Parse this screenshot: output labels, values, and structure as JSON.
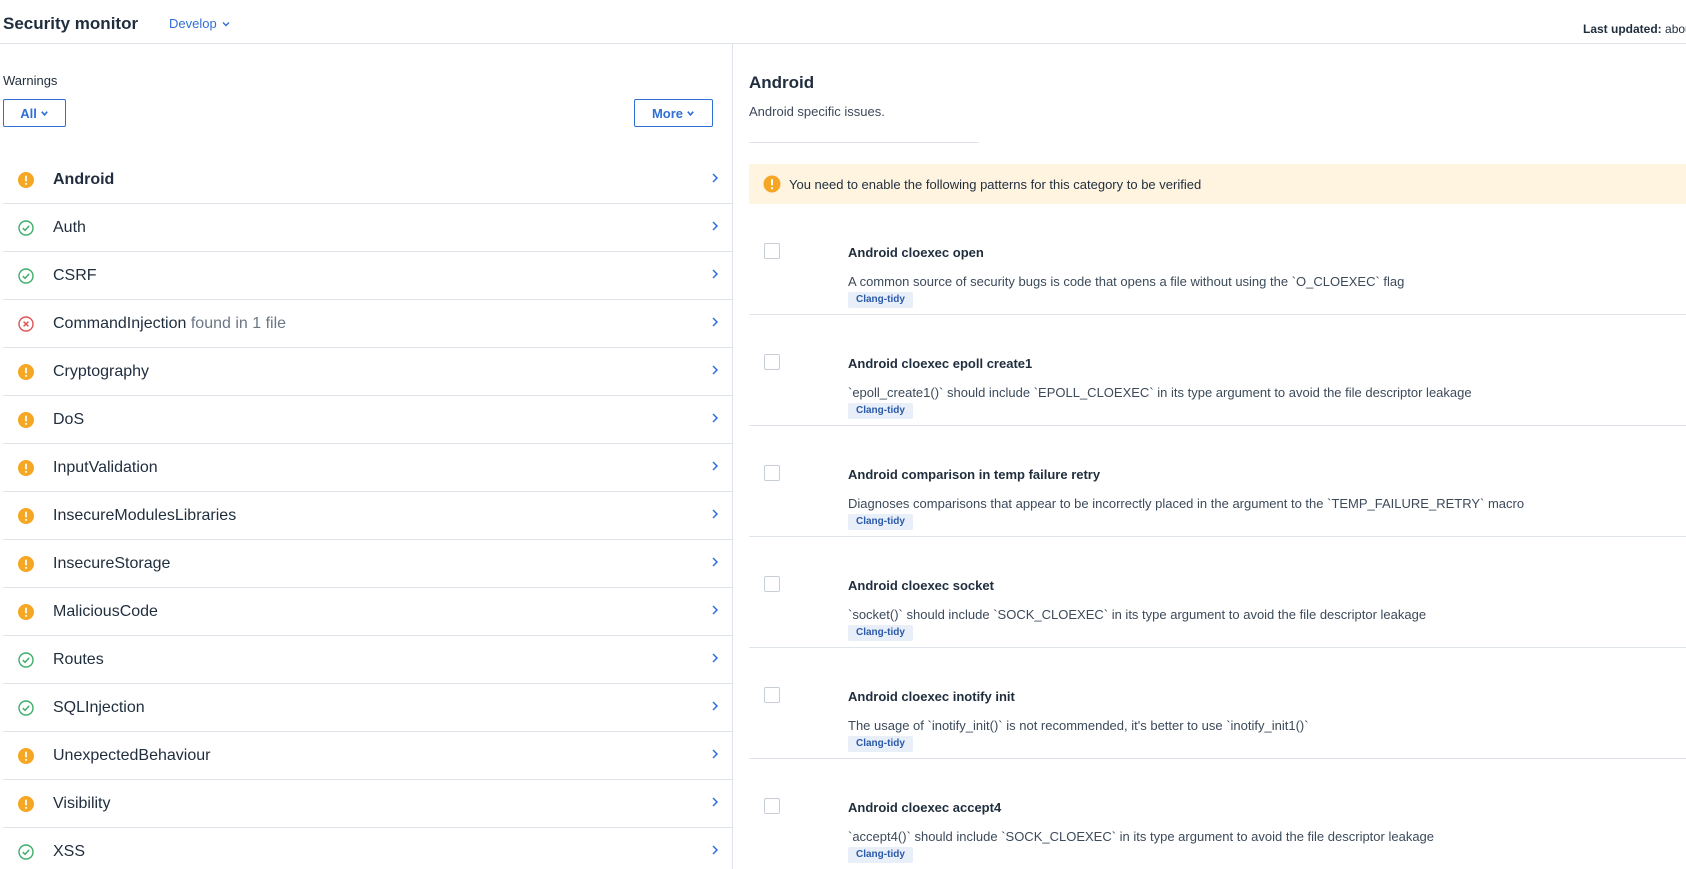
{
  "header": {
    "title": "Security monitor",
    "branch": "Develop",
    "last_updated_label": "Last updated:",
    "last_updated_value": "abou"
  },
  "colors": {
    "accent": "#2f6fd6",
    "warning": "#f5a623",
    "success": "#3fae6a",
    "danger": "#e05252",
    "notice_bg": "#fff4e0",
    "tag_bg": "#e8eff9"
  },
  "sidebar": {
    "warnings_label": "Warnings",
    "filter_all": "All",
    "filter_more": "More",
    "categories": [
      {
        "name": "Android",
        "status": "warning",
        "icon": "warning-icon",
        "found": ""
      },
      {
        "name": "Auth",
        "status": "ok",
        "icon": "check-circle-icon",
        "found": ""
      },
      {
        "name": "CSRF",
        "status": "ok",
        "icon": "check-circle-icon",
        "found": ""
      },
      {
        "name": "CommandInjection",
        "status": "error",
        "icon": "error-circle-icon",
        "found": "found in 1 file"
      },
      {
        "name": "Cryptography",
        "status": "warning",
        "icon": "warning-icon",
        "found": ""
      },
      {
        "name": "DoS",
        "status": "warning",
        "icon": "warning-icon",
        "found": ""
      },
      {
        "name": "InputValidation",
        "status": "warning",
        "icon": "warning-icon",
        "found": ""
      },
      {
        "name": "InsecureModulesLibraries",
        "status": "warning",
        "icon": "warning-icon",
        "found": ""
      },
      {
        "name": "InsecureStorage",
        "status": "warning",
        "icon": "warning-icon",
        "found": ""
      },
      {
        "name": "MaliciousCode",
        "status": "warning",
        "icon": "warning-icon",
        "found": ""
      },
      {
        "name": "Routes",
        "status": "ok",
        "icon": "check-circle-icon",
        "found": ""
      },
      {
        "name": "SQLInjection",
        "status": "ok",
        "icon": "check-circle-icon",
        "found": ""
      },
      {
        "name": "UnexpectedBehaviour",
        "status": "warning",
        "icon": "warning-icon",
        "found": ""
      },
      {
        "name": "Visibility",
        "status": "warning",
        "icon": "warning-icon",
        "found": ""
      },
      {
        "name": "XSS",
        "status": "ok",
        "icon": "check-circle-icon",
        "found": ""
      }
    ]
  },
  "detail": {
    "title": "Android",
    "description": "Android specific issues.",
    "notice": "You need to enable the following patterns for this category to be verified",
    "patterns": [
      {
        "name": "Android cloexec open",
        "description": "A common source of security bugs is code that opens a file without using the `O_CLOEXEC` flag",
        "tag": "Clang-tidy"
      },
      {
        "name": "Android cloexec epoll create1",
        "description": "`epoll_create1()` should include `EPOLL_CLOEXEC` in its type argument to avoid the file descriptor leakage",
        "tag": "Clang-tidy"
      },
      {
        "name": "Android comparison in temp failure retry",
        "description": "Diagnoses comparisons that appear to be incorrectly placed in the argument to the `TEMP_FAILURE_RETRY` macro",
        "tag": "Clang-tidy"
      },
      {
        "name": "Android cloexec socket",
        "description": "`socket()` should include `SOCK_CLOEXEC` in its type argument to avoid the file descriptor leakage",
        "tag": "Clang-tidy"
      },
      {
        "name": "Android cloexec inotify init",
        "description": "The usage of `inotify_init()` is not recommended, it's better to use `inotify_init1()`",
        "tag": "Clang-tidy"
      },
      {
        "name": "Android cloexec accept4",
        "description": "`accept4()` should include `SOCK_CLOEXEC` in its type argument to avoid the file descriptor leakage",
        "tag": "Clang-tidy"
      }
    ]
  }
}
